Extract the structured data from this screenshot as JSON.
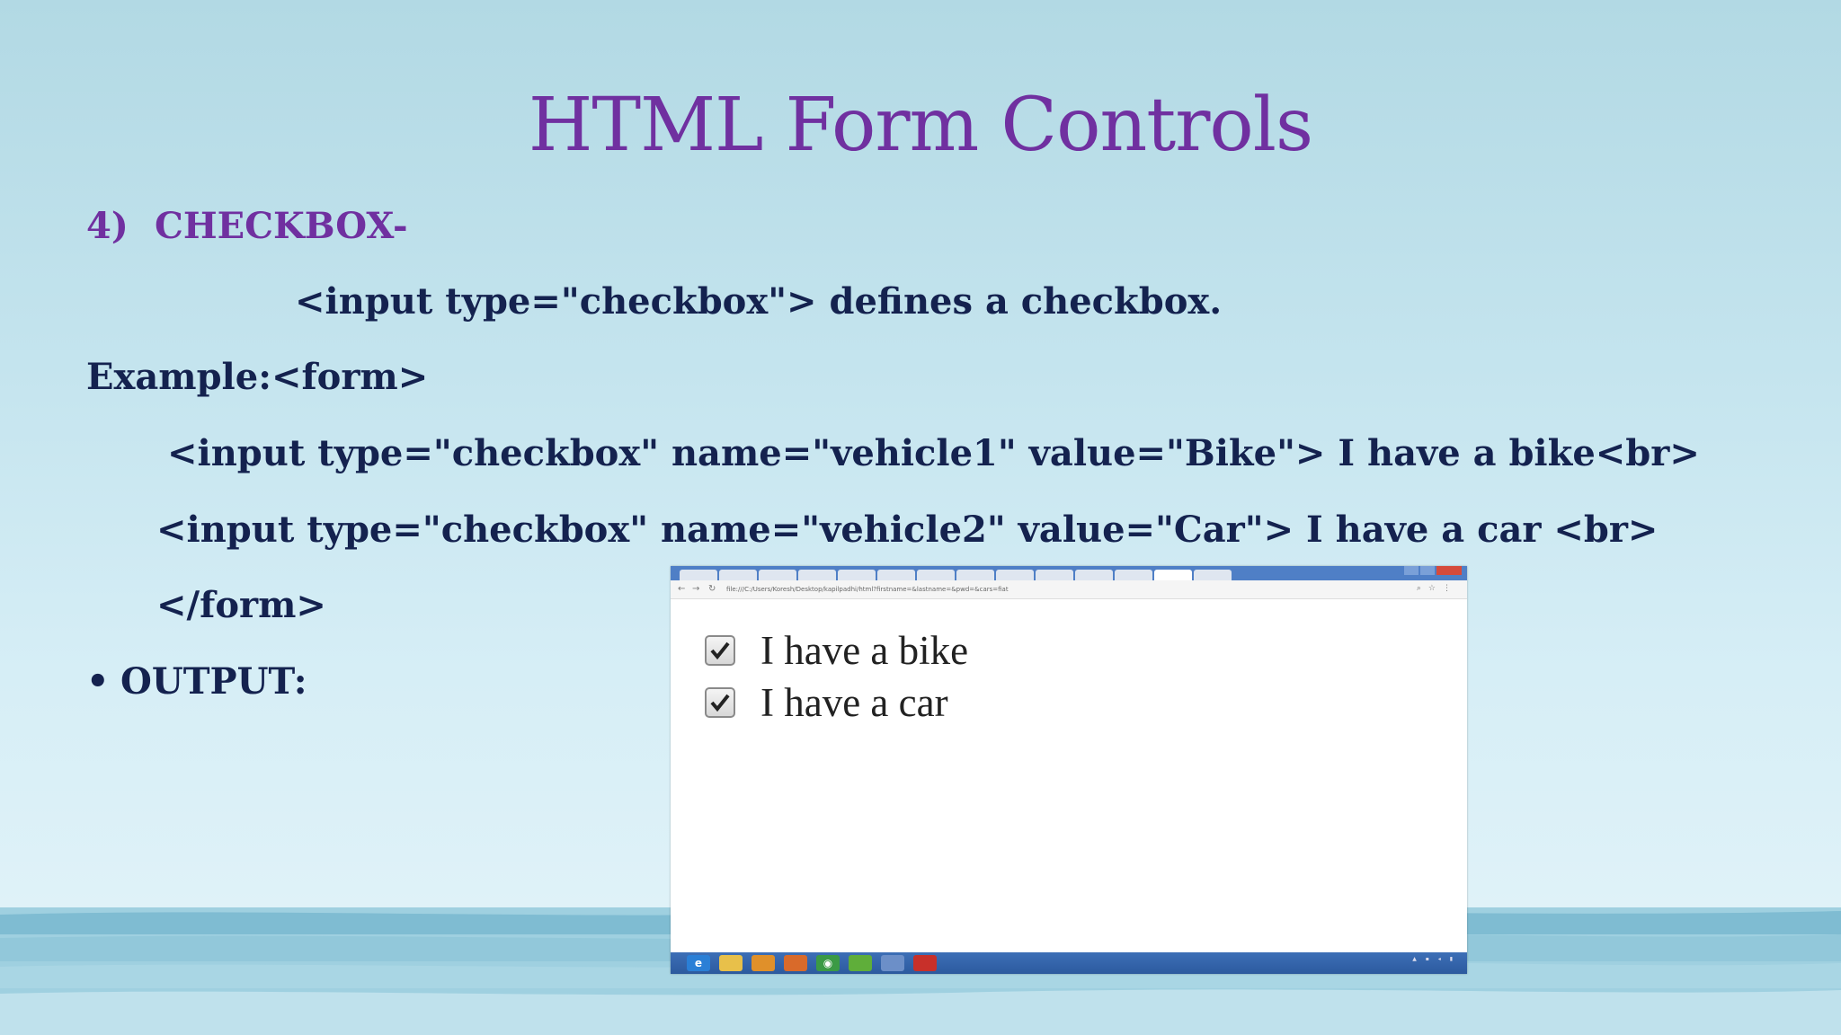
{
  "title": "HTML Form Controls",
  "section": {
    "number": "4)",
    "heading": "CHECKBOX-"
  },
  "lines": {
    "definition": "<input type=\"checkbox\"> defines a checkbox.",
    "example": "Example:<form>",
    "code1": "<input type=\"checkbox\" name=\"vehicle1\" value=\"Bike\"> I have a bike<br>",
    "code2": "<input type=\"checkbox\" name=\"vehicle2\" value=\"Car\"> I have a car <br>",
    "form_close": "</form>"
  },
  "output": {
    "bullet": "•",
    "label": "OUTPUT:"
  },
  "screenshot": {
    "url": "file:///C:/Users/Koresh/Desktop/kapilpadhi/html?firstname=&lastname=&pwd=&cars=fiat",
    "checkboxes": [
      {
        "label": "I have a bike",
        "checked": true
      },
      {
        "label": "I have a car",
        "checked": true
      }
    ],
    "taskbar_icons": [
      "internet-explorer-icon",
      "folder-icon",
      "media-icon",
      "paint-icon",
      "chrome-icon",
      "torrent-icon",
      "app-icon",
      "acrobat-icon"
    ]
  },
  "colors": {
    "title": "#7030a0",
    "body_text": "#14224f",
    "taskbar": "#2c5a9e"
  }
}
